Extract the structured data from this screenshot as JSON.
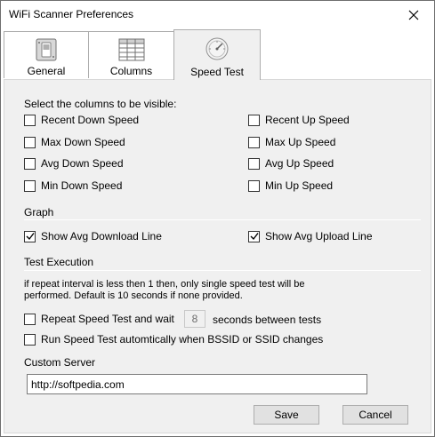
{
  "window": {
    "title": "WiFi Scanner Preferences"
  },
  "tabs": [
    {
      "label": "General",
      "icon": "switch-icon",
      "selected": false
    },
    {
      "label": "Columns",
      "icon": "grid-icon",
      "selected": false
    },
    {
      "label": "Speed Test",
      "icon": "speedometer-icon",
      "selected": true
    }
  ],
  "columns_section": {
    "heading": "Select the columns to be visible:",
    "left": [
      {
        "label": "Recent Down Speed",
        "checked": false
      },
      {
        "label": "Max Down Speed",
        "checked": false
      },
      {
        "label": "Avg Down Speed",
        "checked": false
      },
      {
        "label": "Min Down Speed",
        "checked": false
      }
    ],
    "right": [
      {
        "label": "Recent Up Speed",
        "checked": false
      },
      {
        "label": "Max Up Speed",
        "checked": false
      },
      {
        "label": "Avg Up Speed",
        "checked": false
      },
      {
        "label": "Min Up Speed",
        "checked": false
      }
    ]
  },
  "graph_section": {
    "heading": "Graph",
    "download": {
      "label": "Show Avg Download Line",
      "checked": true
    },
    "upload": {
      "label": "Show Avg Upload Line",
      "checked": true
    }
  },
  "test_section": {
    "heading": "Test Execution",
    "note_line1": "if repeat interval is less then 1 then, only single speed test will be",
    "note_line2": "performed. Default is 10 seconds if none provided.",
    "repeat": {
      "label_before": "Repeat Speed Test and wait",
      "value": "8",
      "label_after": "seconds between tests",
      "checked": false
    },
    "auto": {
      "label": "Run Speed Test automtically when BSSID or SSID changes",
      "checked": false
    }
  },
  "server": {
    "label": "Custom Server",
    "value": "http://softpedia.com"
  },
  "buttons": {
    "save": "Save",
    "cancel": "Cancel"
  },
  "colors": {
    "panel_bg": "#f0f0f0",
    "button_bg": "#e1e1e1",
    "border": "#adadad"
  }
}
